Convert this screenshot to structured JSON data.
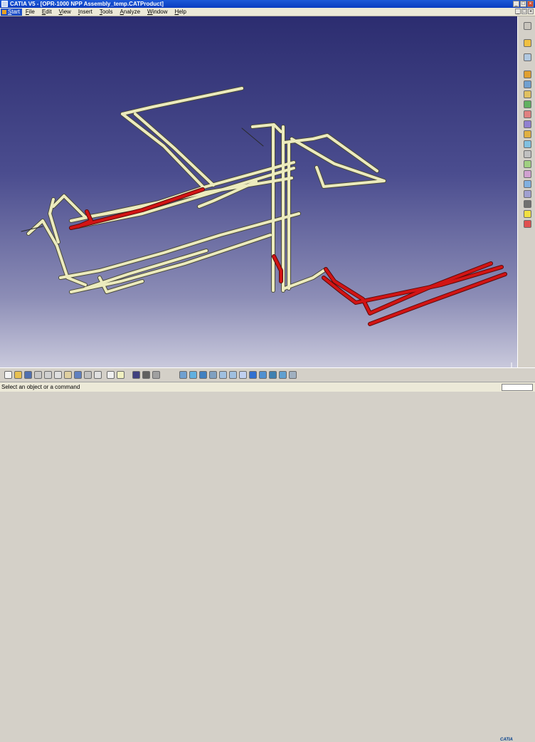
{
  "window": {
    "title": "CATIA V5 - [OPR-1000 NPP Assembly_temp.CATProduct]"
  },
  "menu": {
    "start": "Start",
    "items": [
      "File",
      "Edit",
      "View",
      "Insert",
      "Tools",
      "Analyze",
      "Window",
      "Help"
    ]
  },
  "status": {
    "message": "Select an object or a command"
  },
  "logo": "CATIA",
  "colors": {
    "pipe": "#ecebbe",
    "highlight": "#d21414",
    "background_top": "#2c2d70",
    "background_bottom": "#c9c9dc"
  },
  "toolbar_right": {
    "icons": [
      "compass-icon",
      "select-icon",
      "sketch-icon",
      "part-icon",
      "assembly-icon",
      "constraint-icon",
      "move-icon",
      "snap-icon",
      "explode-icon",
      "clash-icon",
      "section-icon",
      "measure-icon",
      "catalog-icon",
      "scene-icon",
      "publish-icon",
      "tree-icon",
      "camera-icon",
      "light-icon",
      "delete-icon"
    ]
  },
  "toolbar_bottom": {
    "icons": [
      "new-icon",
      "open-icon",
      "save-icon",
      "print-icon",
      "cut-icon",
      "copy-icon",
      "paste-icon",
      "undo-icon",
      "redo-icon",
      "whats-this-icon",
      "formula-icon",
      "comment-icon",
      "catalog-icon",
      "knowledge-icon",
      "properties-icon",
      "fly-icon",
      "fit-all-icon",
      "pan-icon",
      "rotate-icon",
      "zoom-in-icon",
      "zoom-out-icon",
      "normal-view-icon",
      "iso-view-icon",
      "shading-icon",
      "hide-show-icon",
      "swap-space-icon",
      "render-icon"
    ]
  }
}
